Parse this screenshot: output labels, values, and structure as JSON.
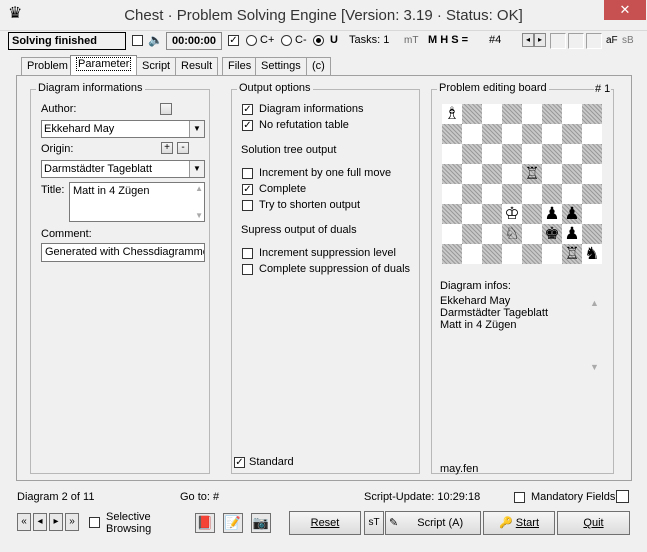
{
  "window": {
    "title": "Chest · Problem Solving Engine [Version: 3.19 · Status: OK]",
    "close": "✕"
  },
  "toolbar": {
    "status": "Solving finished",
    "time": "00:00:00",
    "radio_c_plus": "C+",
    "radio_c_minus": "C-",
    "radio_u": "U",
    "tasks": "Tasks: 1",
    "mt": "mT",
    "mhs": "M H S =",
    "moves": "#4",
    "af": "aF",
    "sb": "sB"
  },
  "tabs": [
    "Problem",
    "Parameter",
    "Script",
    "Result",
    "Files",
    "Settings",
    "(c)"
  ],
  "diagram_info": {
    "group_title": "Diagram informations",
    "author_label": "Author:",
    "author_value": "Ekkehard May",
    "origin_label": "Origin:",
    "origin_value": "Darmstädter Tageblatt",
    "plus": "+",
    "minus": "-",
    "title_label": "Title:",
    "title_value": "Matt in 4 Zügen",
    "comment_label": "Comment:",
    "comment_value": "Generated with Chessdiagrammer"
  },
  "output_options": {
    "group_title": "Output options",
    "diagram_info": "Diagram informations",
    "no_refutation": "No refutation table",
    "solution_tree": "Solution tree output",
    "increment_move": "Increment by one full move",
    "complete": "Complete",
    "shorten": "Try to shorten output",
    "supress_title": "Supress output of duals",
    "increment_suppression": "Increment suppression level",
    "complete_suppression": "Complete suppression of duals",
    "standard": "Standard"
  },
  "board_panel": {
    "group_title": "Problem editing board",
    "number": "# 1",
    "infos_label": "Diagram infos:",
    "infos_lines": [
      "Ekkehard May",
      "Darmstädter Tageblatt",
      "Matt in 4 Zügen"
    ],
    "file": "may.fen"
  },
  "statusbar": {
    "diagram": "Diagram 2 of 11",
    "goto": "Go to: #",
    "script_update": "Script-Update: 10:29:18",
    "mandatory": "Mandatory Fields",
    "selective": "Selective",
    "browsing": "Browsing",
    "reset": "Reset",
    "st": "sT",
    "script_btn": "Script (A)",
    "start": "Start",
    "quit": "Quit"
  }
}
